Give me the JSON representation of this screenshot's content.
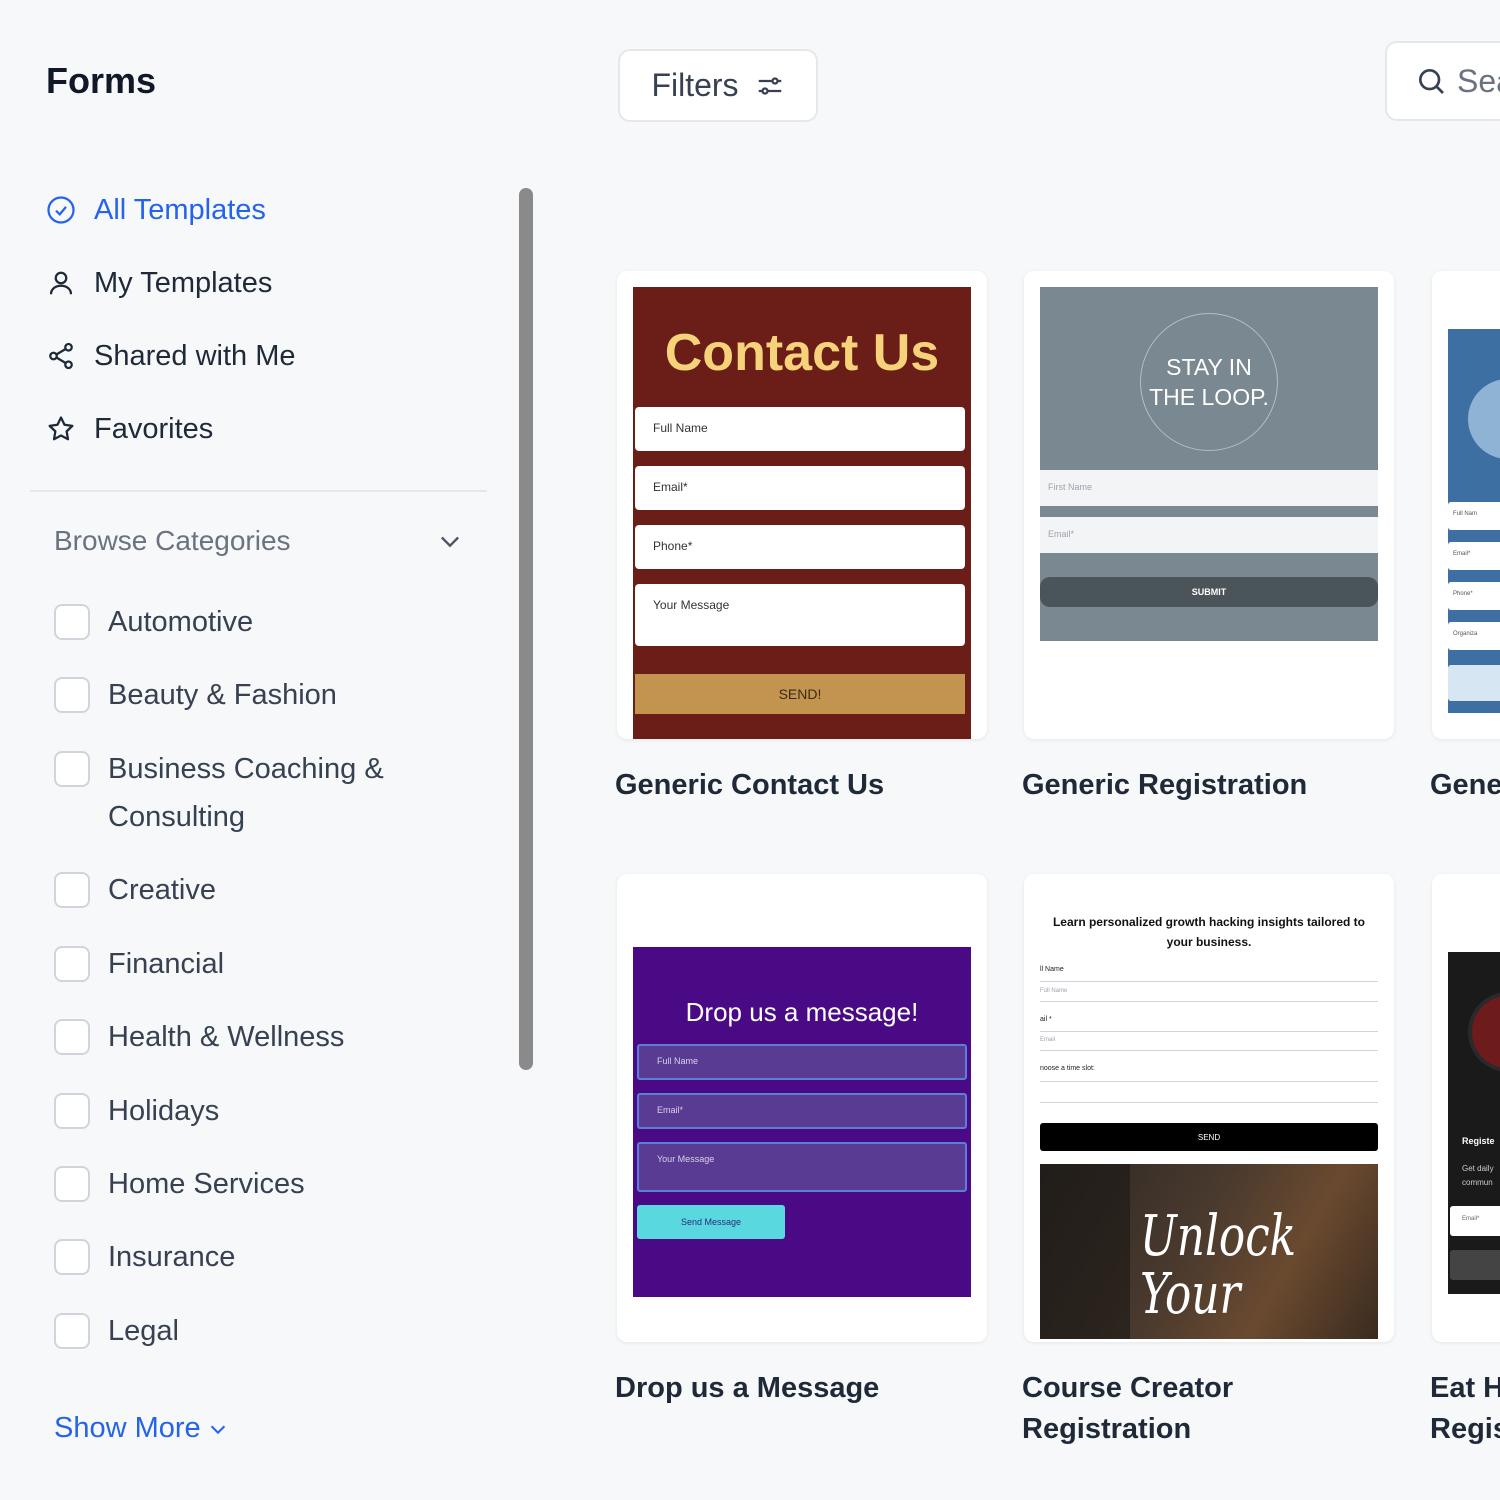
{
  "sidebar": {
    "title": "Forms",
    "nav": [
      {
        "label": "All Templates",
        "icon": "check-circle-icon",
        "active": true
      },
      {
        "label": "My Templates",
        "icon": "user-icon",
        "active": false
      },
      {
        "label": "Shared with Me",
        "icon": "share-icon",
        "active": false
      },
      {
        "label": "Favorites",
        "icon": "star-icon",
        "active": false
      }
    ],
    "browse_label": "Browse Categories",
    "categories": [
      "Automotive",
      "Beauty & Fashion",
      "Business Coaching & Consulting",
      "Creative",
      "Financial",
      "Health & Wellness",
      "Holidays",
      "Home Services",
      "Insurance",
      "Legal"
    ],
    "show_more": "Show More"
  },
  "toolbar": {
    "filters_label": "Filters",
    "search_text": "Sea"
  },
  "templates": [
    {
      "title": "Generic Contact Us",
      "preview": {
        "heading": "Contact Us",
        "fields": [
          "Full Name",
          "Email*",
          "Phone*",
          "Your Message"
        ],
        "button": "SEND!"
      }
    },
    {
      "title": "Generic Registration",
      "preview": {
        "heading": "STAY IN THE LOOP.",
        "fields": [
          "First Name",
          "Email*"
        ],
        "button": "SUBMIT"
      }
    },
    {
      "title": "Gene",
      "preview": {
        "fields": [
          "Full Nam",
          "Email*",
          "Phone*",
          "Organiza"
        ]
      }
    },
    {
      "title": "Drop us a Message",
      "preview": {
        "heading": "Drop us a message!",
        "fields": [
          "Full Name",
          "Email*",
          "Your Message"
        ],
        "button": "Send Message"
      }
    },
    {
      "title": "Course Creator Registration",
      "preview": {
        "heading": "Learn personalized growth hacking insights tailored to your business.",
        "labels": [
          "ll Name",
          "ail *",
          "noose a time slot:"
        ],
        "placeholders": [
          "Full Name",
          "Email"
        ],
        "button": "SEND",
        "image_text": "Unlock Your"
      }
    },
    {
      "title": "Eat H Regis",
      "preview": {
        "heading": "Registe",
        "text": "Get daily commun",
        "fields": [
          "Email*"
        ]
      }
    }
  ],
  "colors": {
    "accent": "#2563eb",
    "contact_bg": "#6b1d18",
    "contact_heading": "#f6d27a",
    "contact_button": "#c3944f",
    "registration_bg": "#798891",
    "message_bg": "#4a0a86",
    "message_button": "#5ad8e0"
  }
}
